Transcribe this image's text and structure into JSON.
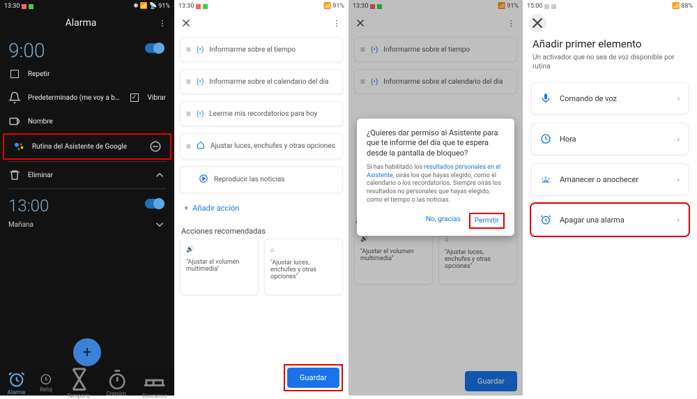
{
  "s1": {
    "status_time": "13:30",
    "battery": "91%",
    "header_title": "Alarma",
    "alarm1_time": "9:00",
    "repeat": "Repetir",
    "ringtone": "Predeterminado (me voy a bañ…",
    "vibrate": "Vibrar",
    "name_label": "Nombre",
    "google_routine": "Rutina del Asistente de Google",
    "delete": "Eliminar",
    "alarm2_time": "13:00",
    "tomorrow": "Mañana",
    "nav": [
      "Alarma",
      "Reloj",
      "Temporiz.",
      "Cronóm.",
      "Descanso"
    ]
  },
  "s2": {
    "status_time": "13:30",
    "battery": "91%",
    "cards": [
      "Informarme sobre el tiempo",
      "Informarme sobre el calendario del día",
      "Leerme mis recordatorios para hoy",
      "Ajustar luces, enchufes y otras opciones",
      "Reproducir las noticias"
    ],
    "add_action": "Añadir acción",
    "recommended": "Acciones recomendadas",
    "reco1": "\"Ajustar el volumen multimedia\"",
    "reco2": "\"Ajustar luces, enchufes y otras opciones\"",
    "save": "Guardar"
  },
  "s3": {
    "status_time": "13:30",
    "battery": "91%",
    "cards": [
      "Informarme sobre el tiempo",
      "Informarme sobre el calendario del día"
    ],
    "dlg_title": "¿Quieres dar permiso al Asistente para que te informe del día que te espera desde la pantalla de bloqueo?",
    "dlg_body1": "Si has habilitado los ",
    "dlg_body_link": "resultados personales en el Asistente",
    "dlg_body2": ", oirás los que hayas elegido, como el calendario o los recordatorios. Siempre oirás los resultados no personales que hayas elegido, como el tiempo o las noticias.",
    "no": "No, gracias",
    "allow": "Permitir",
    "recommended": "Acciones recomendadas",
    "reco1": "\"Ajustar el volumen multimedia\"",
    "reco2": "\"Ajustar luces, enchufes y otras opciones\"",
    "save": "Guardar"
  },
  "s4": {
    "status_time": "15:00",
    "battery": "88%",
    "title": "Añadir primer elemento",
    "subtitle": "Un activador que no sea de voz disponible por rutina",
    "opts": [
      "Comando de voz",
      "Hora",
      "Amanecer o anochecer",
      "Apagar una alarma"
    ]
  }
}
